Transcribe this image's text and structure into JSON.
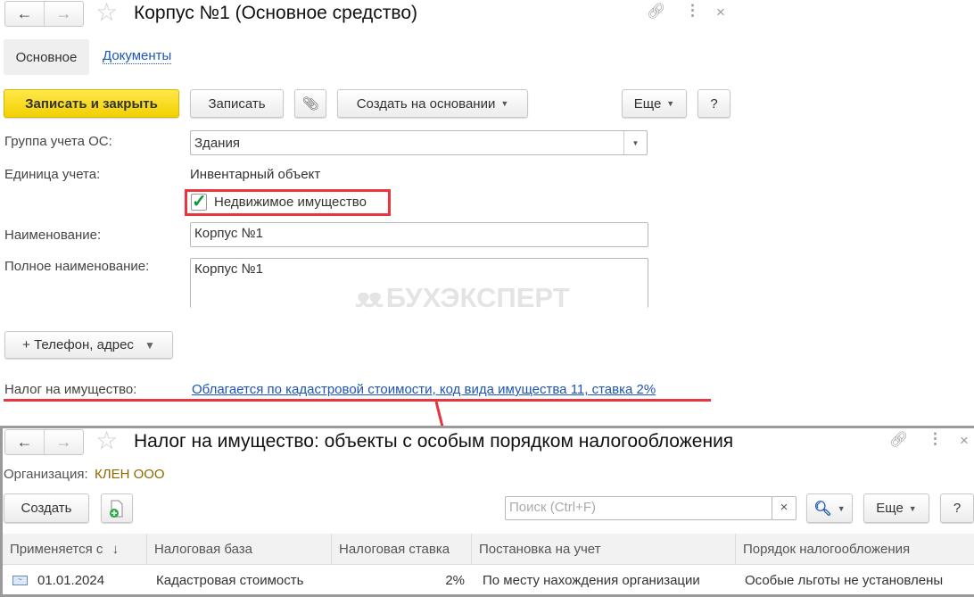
{
  "main_window": {
    "title": "Корпус №1 (Основное средство)",
    "nav": {
      "back": "←",
      "forward": "→"
    },
    "tabs": [
      {
        "label": "Основное",
        "active": true
      },
      {
        "label": "Документы",
        "active": false
      }
    ],
    "toolbar": {
      "save_close": "Записать и закрыть",
      "save": "Записать",
      "create_based": "Создать на основании",
      "more": "Еще",
      "help": "?"
    },
    "fields": {
      "group_label": "Группа учета ОС:",
      "group_value": "Здания",
      "unit_label": "Единица учета:",
      "unit_value": "Инвентарный объект",
      "realty_label": "Недвижимое имущество",
      "realty_checked": true,
      "name_label": "Наименование:",
      "name_value": "Корпус №1",
      "fullname_label": "Полное наименование:",
      "fullname_value": "Корпус №1"
    },
    "phone_button": "+ Телефон, адрес",
    "tax_label": "Налог на имущество:",
    "tax_link": "Облагается по кадастровой стоимости, код вида имущества 11, ставка 2%",
    "watermark": "БУХЭКСПЕРТ"
  },
  "sub_window": {
    "title": "Налог на имущество: объекты с особым порядком налогообложения",
    "org_label": "Организация:",
    "org_value": "КЛЕН ООО",
    "create": "Создать",
    "search_placeholder": "Поиск (Ctrl+F)",
    "search_clear": "×",
    "more": "Еще",
    "help": "?",
    "columns": [
      "Применяется с",
      "Налоговая база",
      "Налоговая ставка",
      "Постановка на учет",
      "Порядок налогообложения"
    ],
    "sort_indicator": "↓",
    "rows": [
      [
        "01.01.2024",
        "Кадастровая стоимость",
        "2%",
        "По месту нахождения организации",
        "Особые льготы не установлены"
      ]
    ]
  },
  "colors": {
    "accent_yellow": "#f5d400",
    "link": "#1a55b8",
    "highlight_red": "#e8363d",
    "org": "#8a6a00"
  }
}
